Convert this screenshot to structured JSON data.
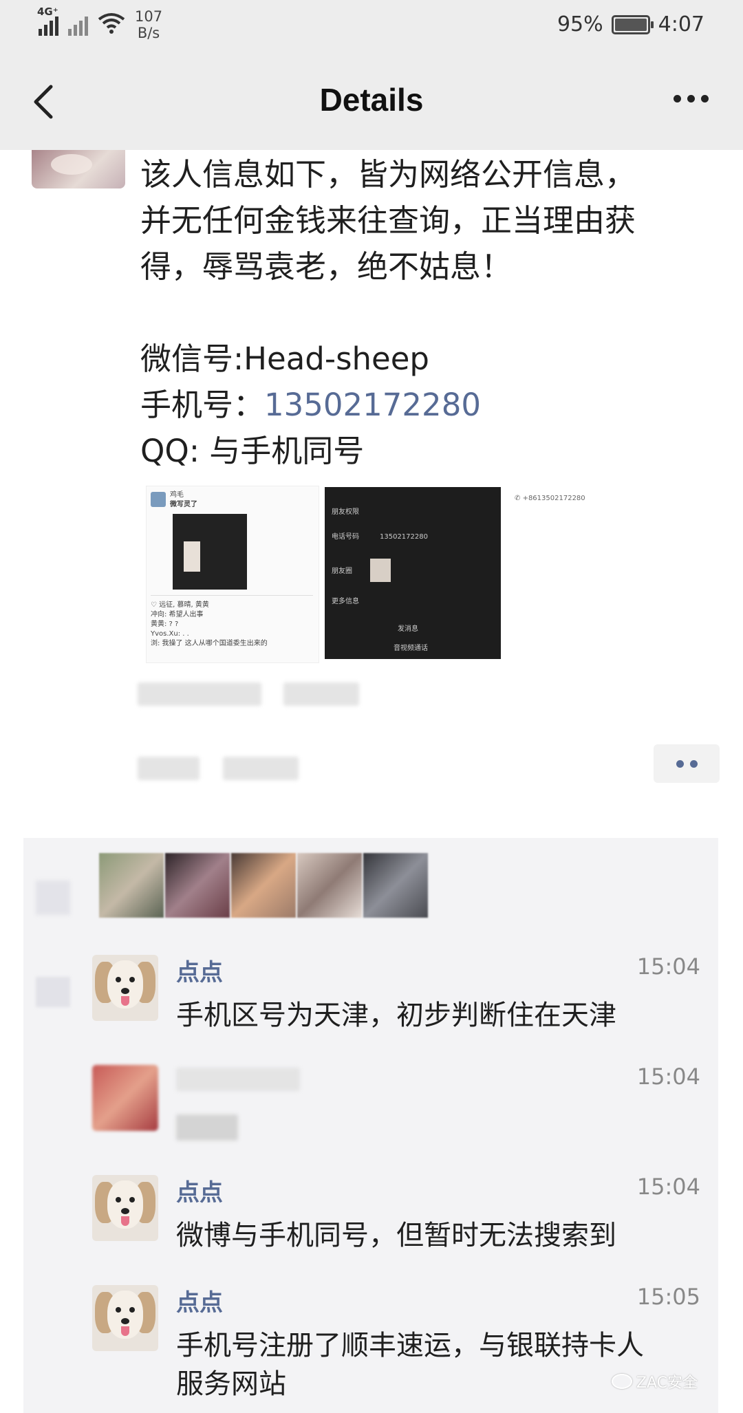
{
  "status_bar": {
    "network": "4G⁺",
    "net_speed_value": "107",
    "net_speed_unit": "B/s",
    "battery": "95%",
    "time": "4:07"
  },
  "nav": {
    "title": "Details",
    "back_icon": "chevron-left-icon",
    "more_icon": "more-dots-icon"
  },
  "post": {
    "lines": [
      "该人信息如下，皆为网络公开信息，",
      "并无任何金钱来往查询，正当理由获",
      "得，辱骂袁老，绝不姑息！"
    ],
    "wechat_label": "微信号:",
    "wechat_value": "Head-sheep",
    "phone_label": "手机号：",
    "phone_value": "13502172280",
    "qq_line": "QQ: 与手机同号",
    "shot1": {
      "name": "鸡毛",
      "caption": "微写灵了",
      "lines": [
        "♡ 远征, 慕晴, 黄黄",
        "冲向: 希望人出事",
        "黄黄: ? ?",
        "Yvos.Xu: . .",
        "浏: 我操了 这人从哪个国道委生出来的"
      ]
    },
    "shot2": {
      "rows": [
        "朋友权限",
        "电话号码",
        "朋友圈",
        "更多信息"
      ],
      "phone": "13502172280",
      "actions": [
        "发消息",
        "音视频通话"
      ]
    },
    "shot3": {
      "phone": "+8613502172280"
    }
  },
  "comments": [
    {
      "name": "点点",
      "time": "15:04",
      "text": "手机区号为天津，初步判断住在天津",
      "avatar": "dog"
    },
    {
      "name": "",
      "time": "15:04",
      "text": "",
      "avatar": "blurred"
    },
    {
      "name": "点点",
      "time": "15:04",
      "text": "微博与手机同号，但暂时无法搜索到",
      "avatar": "dog"
    },
    {
      "name": "点点",
      "time": "15:05",
      "text": "手机号注册了顺丰速运，与银联持卡人服务网站",
      "avatar": "dog"
    }
  ],
  "watermark": "ZAC安全",
  "colors": {
    "link": "#576b95",
    "bar": "#ededed",
    "panel": "#f3f3f5"
  }
}
